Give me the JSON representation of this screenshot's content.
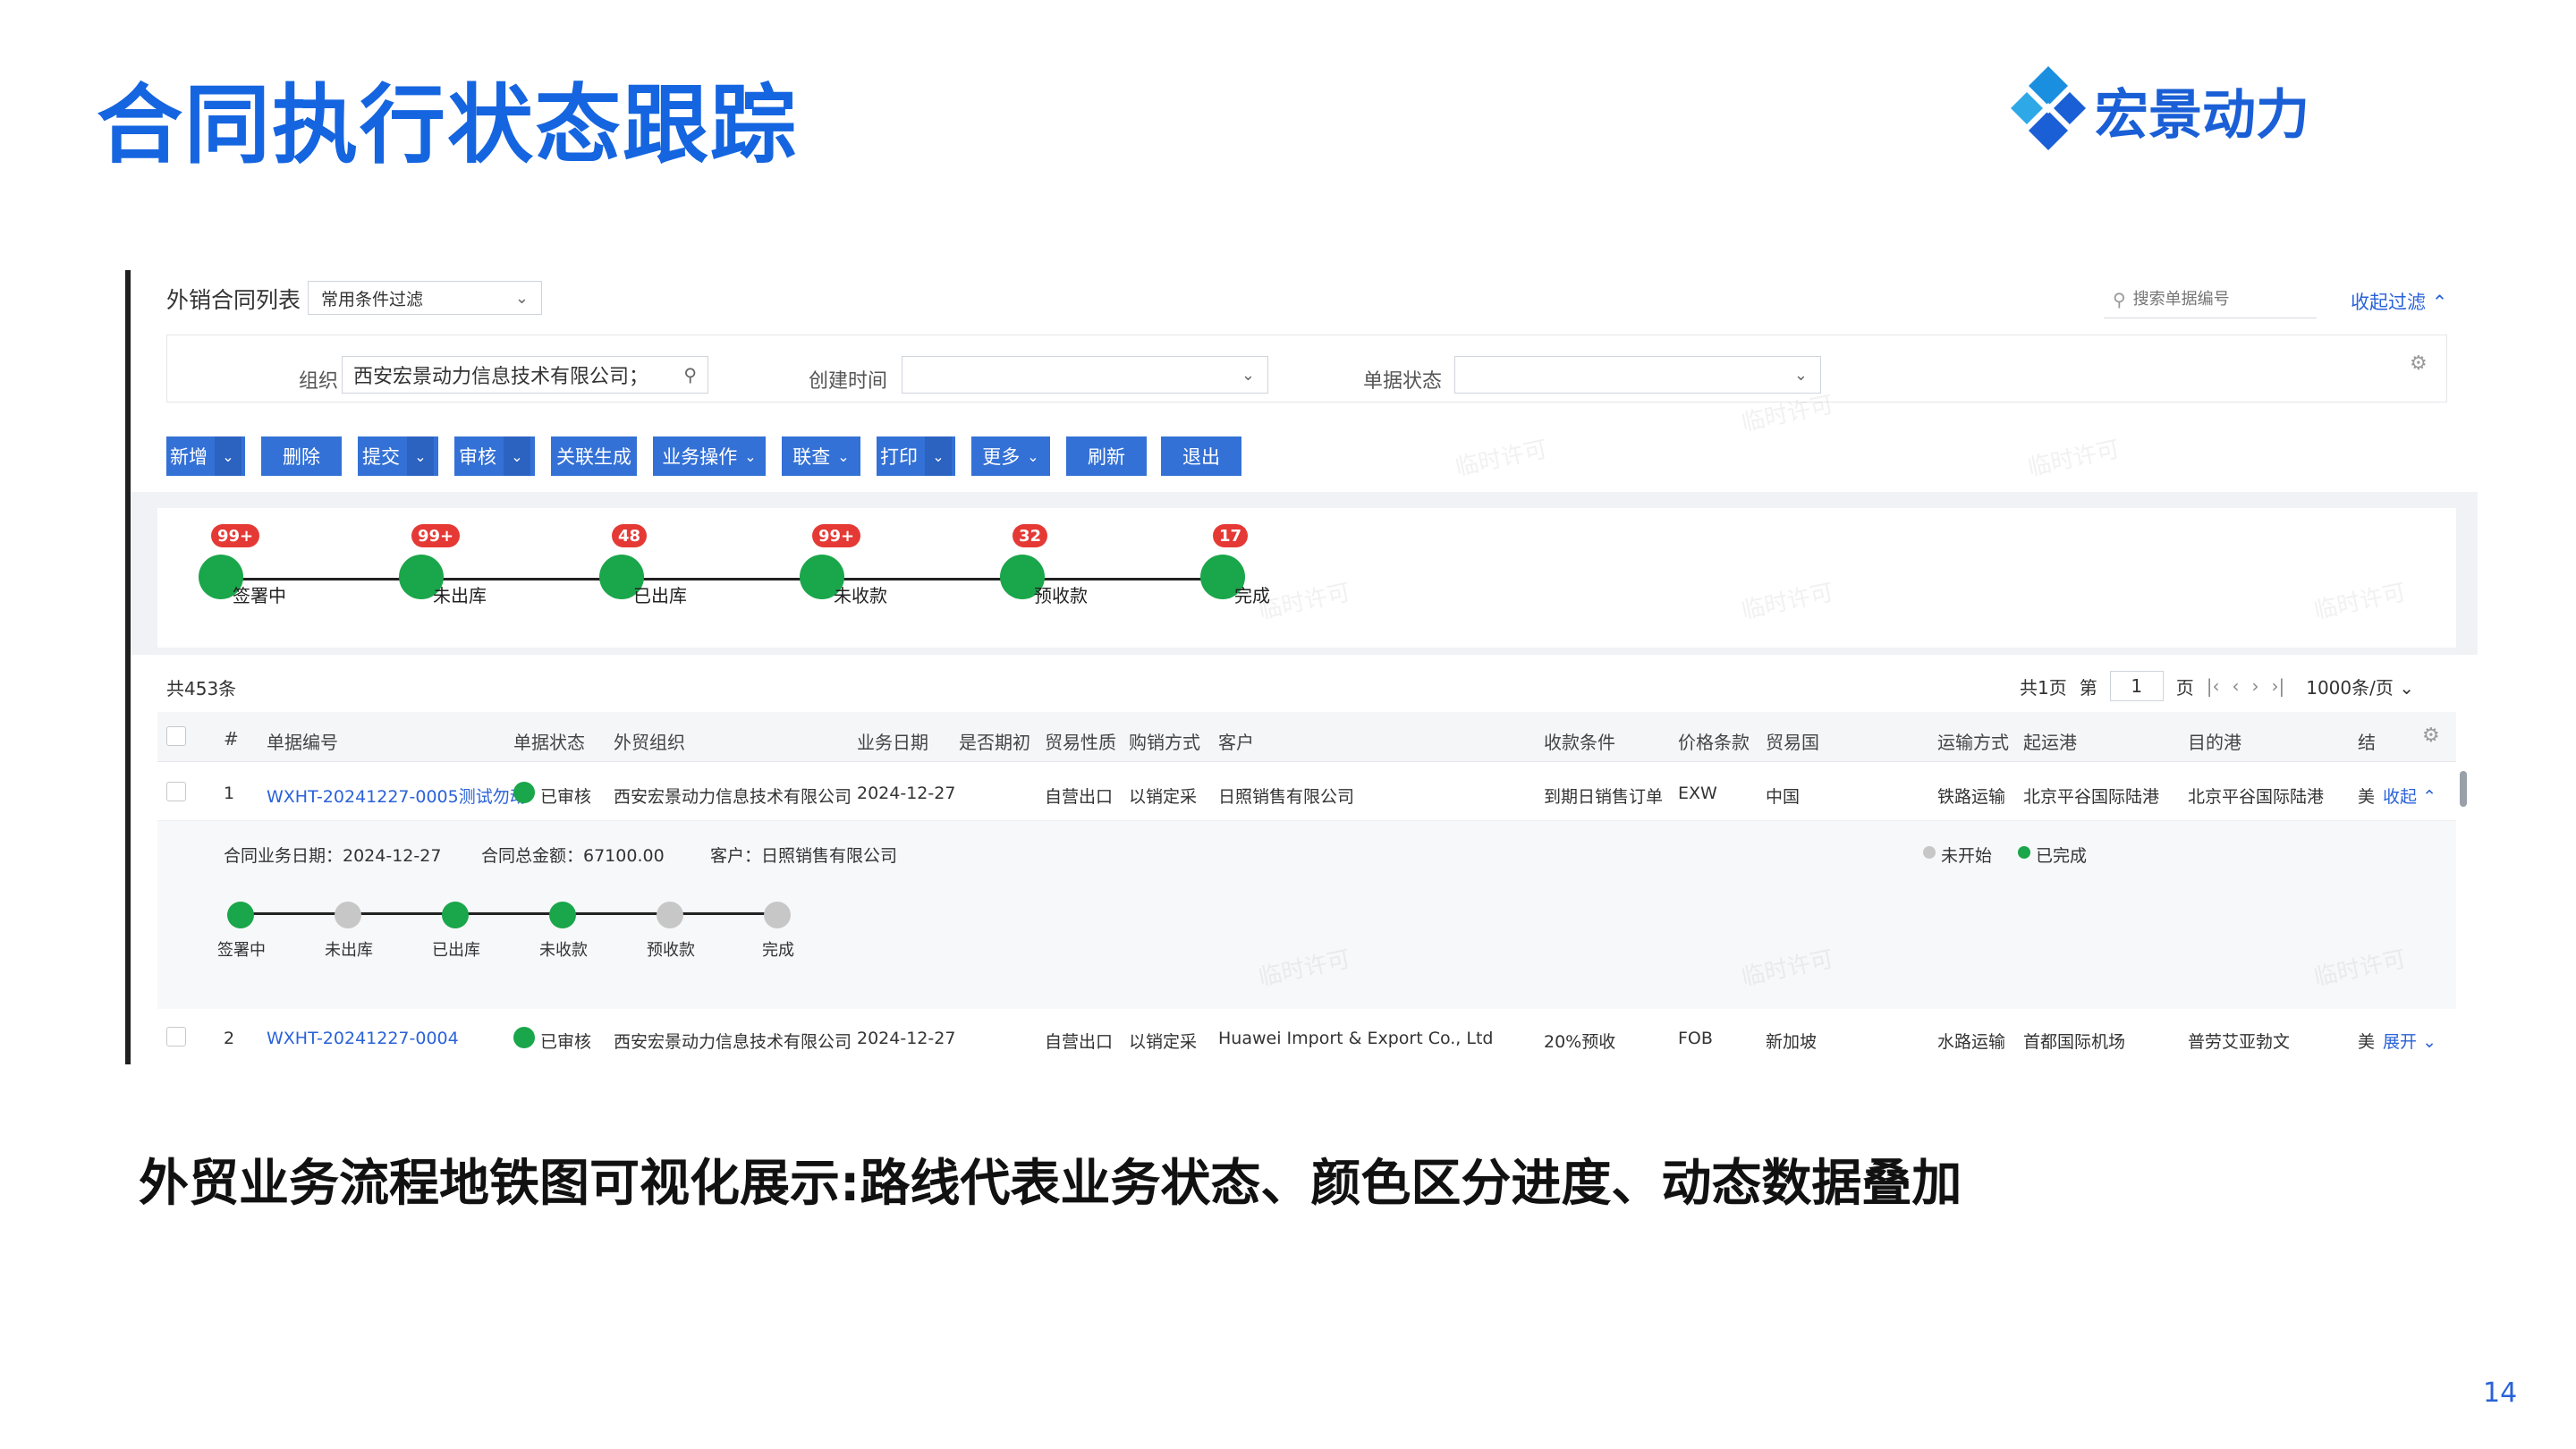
{
  "slide": {
    "title": "合同执行状态跟踪",
    "logo_text": "宏景动力",
    "caption": "外贸业务流程地铁图可视化展示:路线代表业务状态、颜色区分进度、动态数据叠加",
    "page_number": "14"
  },
  "colors": {
    "accent": "#1565e0",
    "button": "#3471d6",
    "done": "#1aa64a",
    "pending": "#c7c7c7",
    "badge": "#e53935"
  },
  "list": {
    "title": "外销合同列表",
    "filter_preset": "常用条件过滤",
    "search_placeholder": "搜索单据编号",
    "collapse_filter": "收起过滤",
    "watermark": "临时许可"
  },
  "filters": {
    "org_label": "组织",
    "org_value": "西安宏景动力信息技术有限公司；",
    "created_label": "创建时间",
    "status_label": "单据状态"
  },
  "toolbar": [
    "新增",
    "删除",
    "提交",
    "审核",
    "关联生成",
    "业务操作",
    "联查",
    "打印",
    "更多",
    "刷新",
    "退出"
  ],
  "summary_stages": [
    {
      "label": "签署中",
      "count": "99+"
    },
    {
      "label": "未出库",
      "count": "99+"
    },
    {
      "label": "已出库",
      "count": "48"
    },
    {
      "label": "未收款",
      "count": "99+"
    },
    {
      "label": "预收款",
      "count": "32"
    },
    {
      "label": "完成",
      "count": "17"
    }
  ],
  "table": {
    "total": "共453条",
    "pager": {
      "total_pages": "共1页",
      "page_prefix": "第",
      "page": "1",
      "page_suffix": "页",
      "page_size": "1000条/页"
    },
    "columns": [
      "#",
      "单据编号",
      "单据状态",
      "外贸组织",
      "业务日期",
      "是否期初",
      "贸易性质",
      "购销方式",
      "客户",
      "收款条件",
      "价格条款",
      "贸易国",
      "运输方式",
      "起运港",
      "目的港",
      "结"
    ],
    "rows": [
      {
        "no": "1",
        "code": "WXHT-20241227-0005测试勿动",
        "status": "已审核",
        "org": "西安宏景动力信息技术有限公司",
        "date": "2024-12-27",
        "initial": "",
        "trade": "自营出口",
        "purchase": "以销定采",
        "customer": "日照销售有限公司",
        "payment": "到期日销售订单",
        "price": "EXW",
        "country": "中国",
        "transport": "铁路运输",
        "from_port": "北京平谷国际陆港",
        "to_port": "北京平谷国际陆港",
        "extra": "美",
        "toggle": "收起"
      },
      {
        "no": "2",
        "code": "WXHT-20241227-0004",
        "status": "已审核",
        "org": "西安宏景动力信息技术有限公司",
        "date": "2024-12-27",
        "initial": "",
        "trade": "自营出口",
        "purchase": "以销定采",
        "customer": "Huawei Import & Export Co., Ltd",
        "payment": "20%预收",
        "price": "FOB",
        "country": "新加坡",
        "transport": "水路运输",
        "from_port": "首都国际机场",
        "to_port": "普劳艾亚勃文",
        "extra": "美",
        "toggle": "展开"
      }
    ]
  },
  "detail": {
    "date_label": "合同业务日期：2024-12-27",
    "amount_label": "合同总金额：67100.00",
    "customer_label": "客户：日照销售有限公司",
    "legend_pending": "未开始",
    "legend_done": "已完成",
    "stages": [
      {
        "label": "签署中",
        "done": true
      },
      {
        "label": "未出库",
        "done": false
      },
      {
        "label": "已出库",
        "done": true
      },
      {
        "label": "未收款",
        "done": true
      },
      {
        "label": "预收款",
        "done": false
      },
      {
        "label": "完成",
        "done": false
      }
    ]
  }
}
